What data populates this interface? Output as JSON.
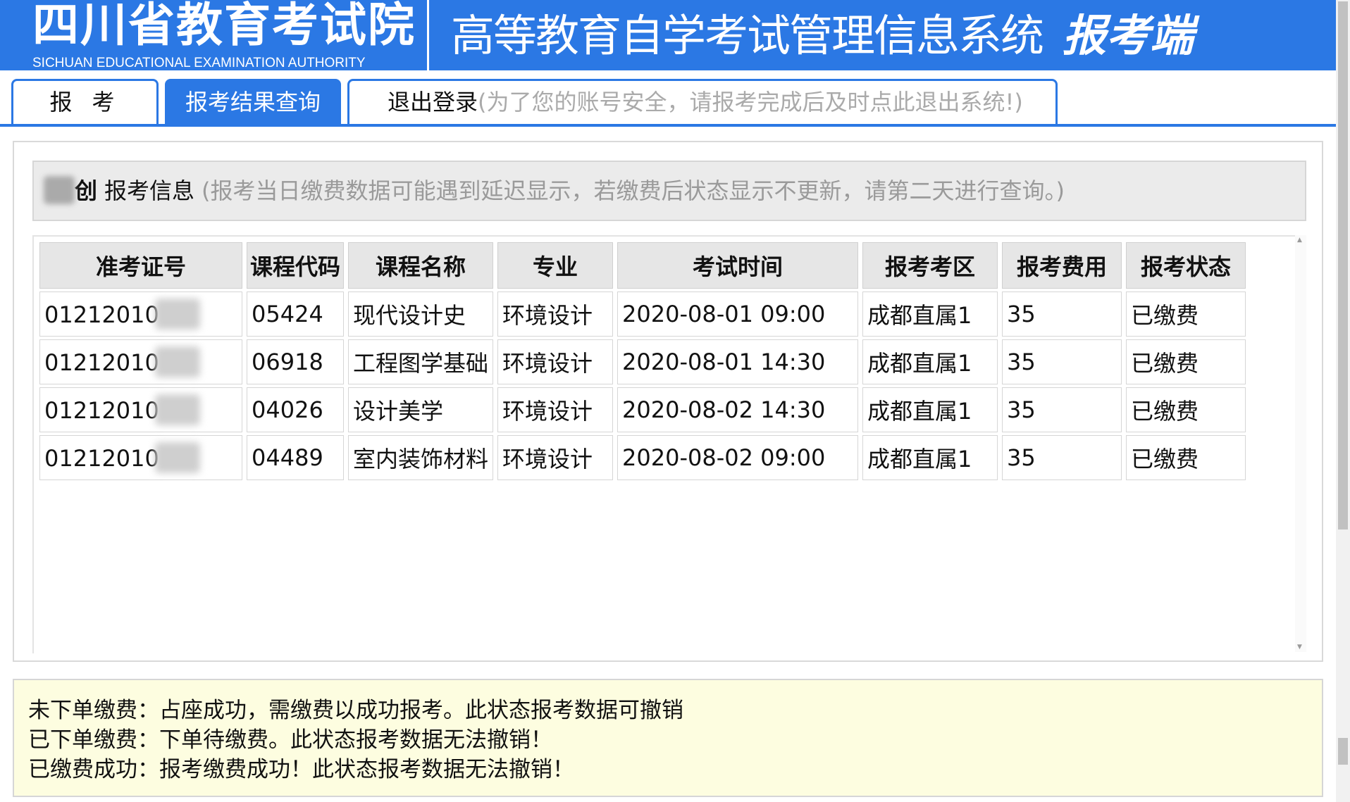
{
  "header": {
    "org_title": "四川省教育考试院",
    "org_subtitle": "SICHUAN EDUCATIONAL EXAMINATION AUTHORITY",
    "system_title": "高等教育自学考试管理信息系统",
    "system_tag": "报考端"
  },
  "tabs": [
    {
      "label": "报考"
    },
    {
      "label": "报考结果查询",
      "active": true
    },
    {
      "label": "退出登录",
      "hint": "(为了您的账号安全，请报考完成后及时点此退出系统!)"
    }
  ],
  "info": {
    "name_visible": "创",
    "label": "报考信息",
    "note": "(报考当日缴费数据可能遇到延迟显示，若缴费后状态显示不更新，请第二天进行查询。)"
  },
  "table": {
    "columns": [
      "准考证号",
      "课程代码",
      "课程名称",
      "专业",
      "考试时间",
      "报考考区",
      "报考费用",
      "报考状态"
    ],
    "rows": [
      {
        "ticket": "01212010",
        "code": "05424",
        "course": "现代设计史",
        "major": "环境设计",
        "time": "2020-08-01 09:00",
        "area": "成都直属1",
        "fee": "35",
        "status": "已缴费"
      },
      {
        "ticket": "01212010",
        "code": "06918",
        "course": "工程图学基础",
        "major": "环境设计",
        "time": "2020-08-01 14:30",
        "area": "成都直属1",
        "fee": "35",
        "status": "已缴费"
      },
      {
        "ticket": "01212010",
        "code": "04026",
        "course": "设计美学",
        "major": "环境设计",
        "time": "2020-08-02 14:30",
        "area": "成都直属1",
        "fee": "35",
        "status": "已缴费"
      },
      {
        "ticket": "01212010",
        "code": "04489",
        "course": "室内装饰材料",
        "major": "环境设计",
        "time": "2020-08-02 09:00",
        "area": "成都直属1",
        "fee": "35",
        "status": "已缴费"
      }
    ]
  },
  "notes": [
    "未下单缴费：占座成功，需缴费以成功报考。此状态报考数据可撤销",
    "已下单缴费：下单待缴费。此状态报考数据无法撤销！",
    "已缴费成功：报考缴费成功！此状态报考数据无法撤销！"
  ],
  "colors": {
    "brand_blue": "#2b78e4",
    "note_background": "#fdfde0"
  }
}
